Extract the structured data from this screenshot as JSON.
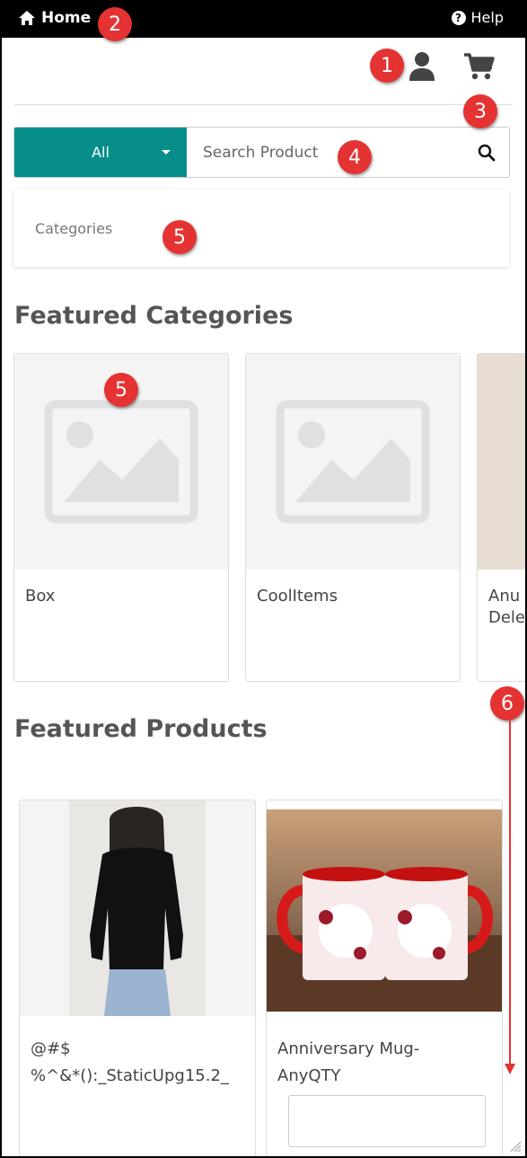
{
  "topbar": {
    "home_label": "Home",
    "help_label": "Help"
  },
  "header": {
    "user_icon": "user-icon",
    "cart_icon": "cart-icon"
  },
  "search": {
    "category_selected": "All",
    "placeholder": "Search Product",
    "button_icon": "search-icon"
  },
  "categories_menu": {
    "label": "Categories"
  },
  "featured_categories": {
    "title": "Featured Categories",
    "items": [
      {
        "name": "Box"
      },
      {
        "name": "CoolItems"
      },
      {
        "name": "Anu\nDele"
      }
    ]
  },
  "featured_products": {
    "title": "Featured Products",
    "items": [
      {
        "name": "@#$\n%^&*():_StaticUpg15.2_"
      },
      {
        "name": "Anniversary Mug-\nAnyQTY"
      }
    ]
  },
  "annotations": [
    "1",
    "2",
    "3",
    "4",
    "5",
    "5",
    "6"
  ],
  "colors": {
    "accent": "#078e8b",
    "topbar": "#000000",
    "badge": "#e53232"
  }
}
